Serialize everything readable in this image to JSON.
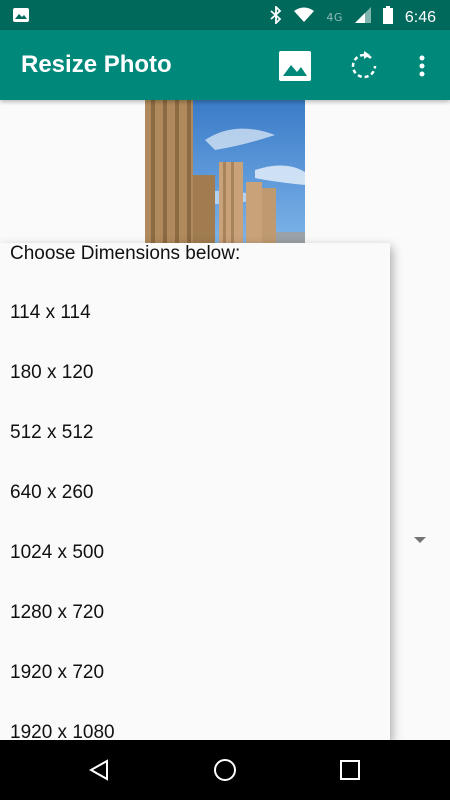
{
  "status_bar": {
    "time": "6:46",
    "network": "4G",
    "icons": [
      "image-notification-icon",
      "bluetooth-icon",
      "wifi-icon",
      "signal-icon",
      "battery-icon"
    ]
  },
  "app_bar": {
    "title": "Resize Photo",
    "actions": [
      "photo-picker-icon",
      "rotate-icon",
      "overflow-menu-icon"
    ],
    "color": "#00897b",
    "status_color": "#00695c"
  },
  "dropdown": {
    "header": "Choose Dimensions below:",
    "options": [
      {
        "label": "114 x 114"
      },
      {
        "label": "180 x 120"
      },
      {
        "label": "512 x 512"
      },
      {
        "label": "640 x 260"
      },
      {
        "label": "1024 x 500"
      },
      {
        "label": "1280 x 720"
      },
      {
        "label": "1920 x 720"
      },
      {
        "label": "1920 x 1080"
      }
    ]
  },
  "nav_bar": {
    "buttons": [
      "back-icon",
      "home-icon",
      "recents-icon"
    ]
  }
}
